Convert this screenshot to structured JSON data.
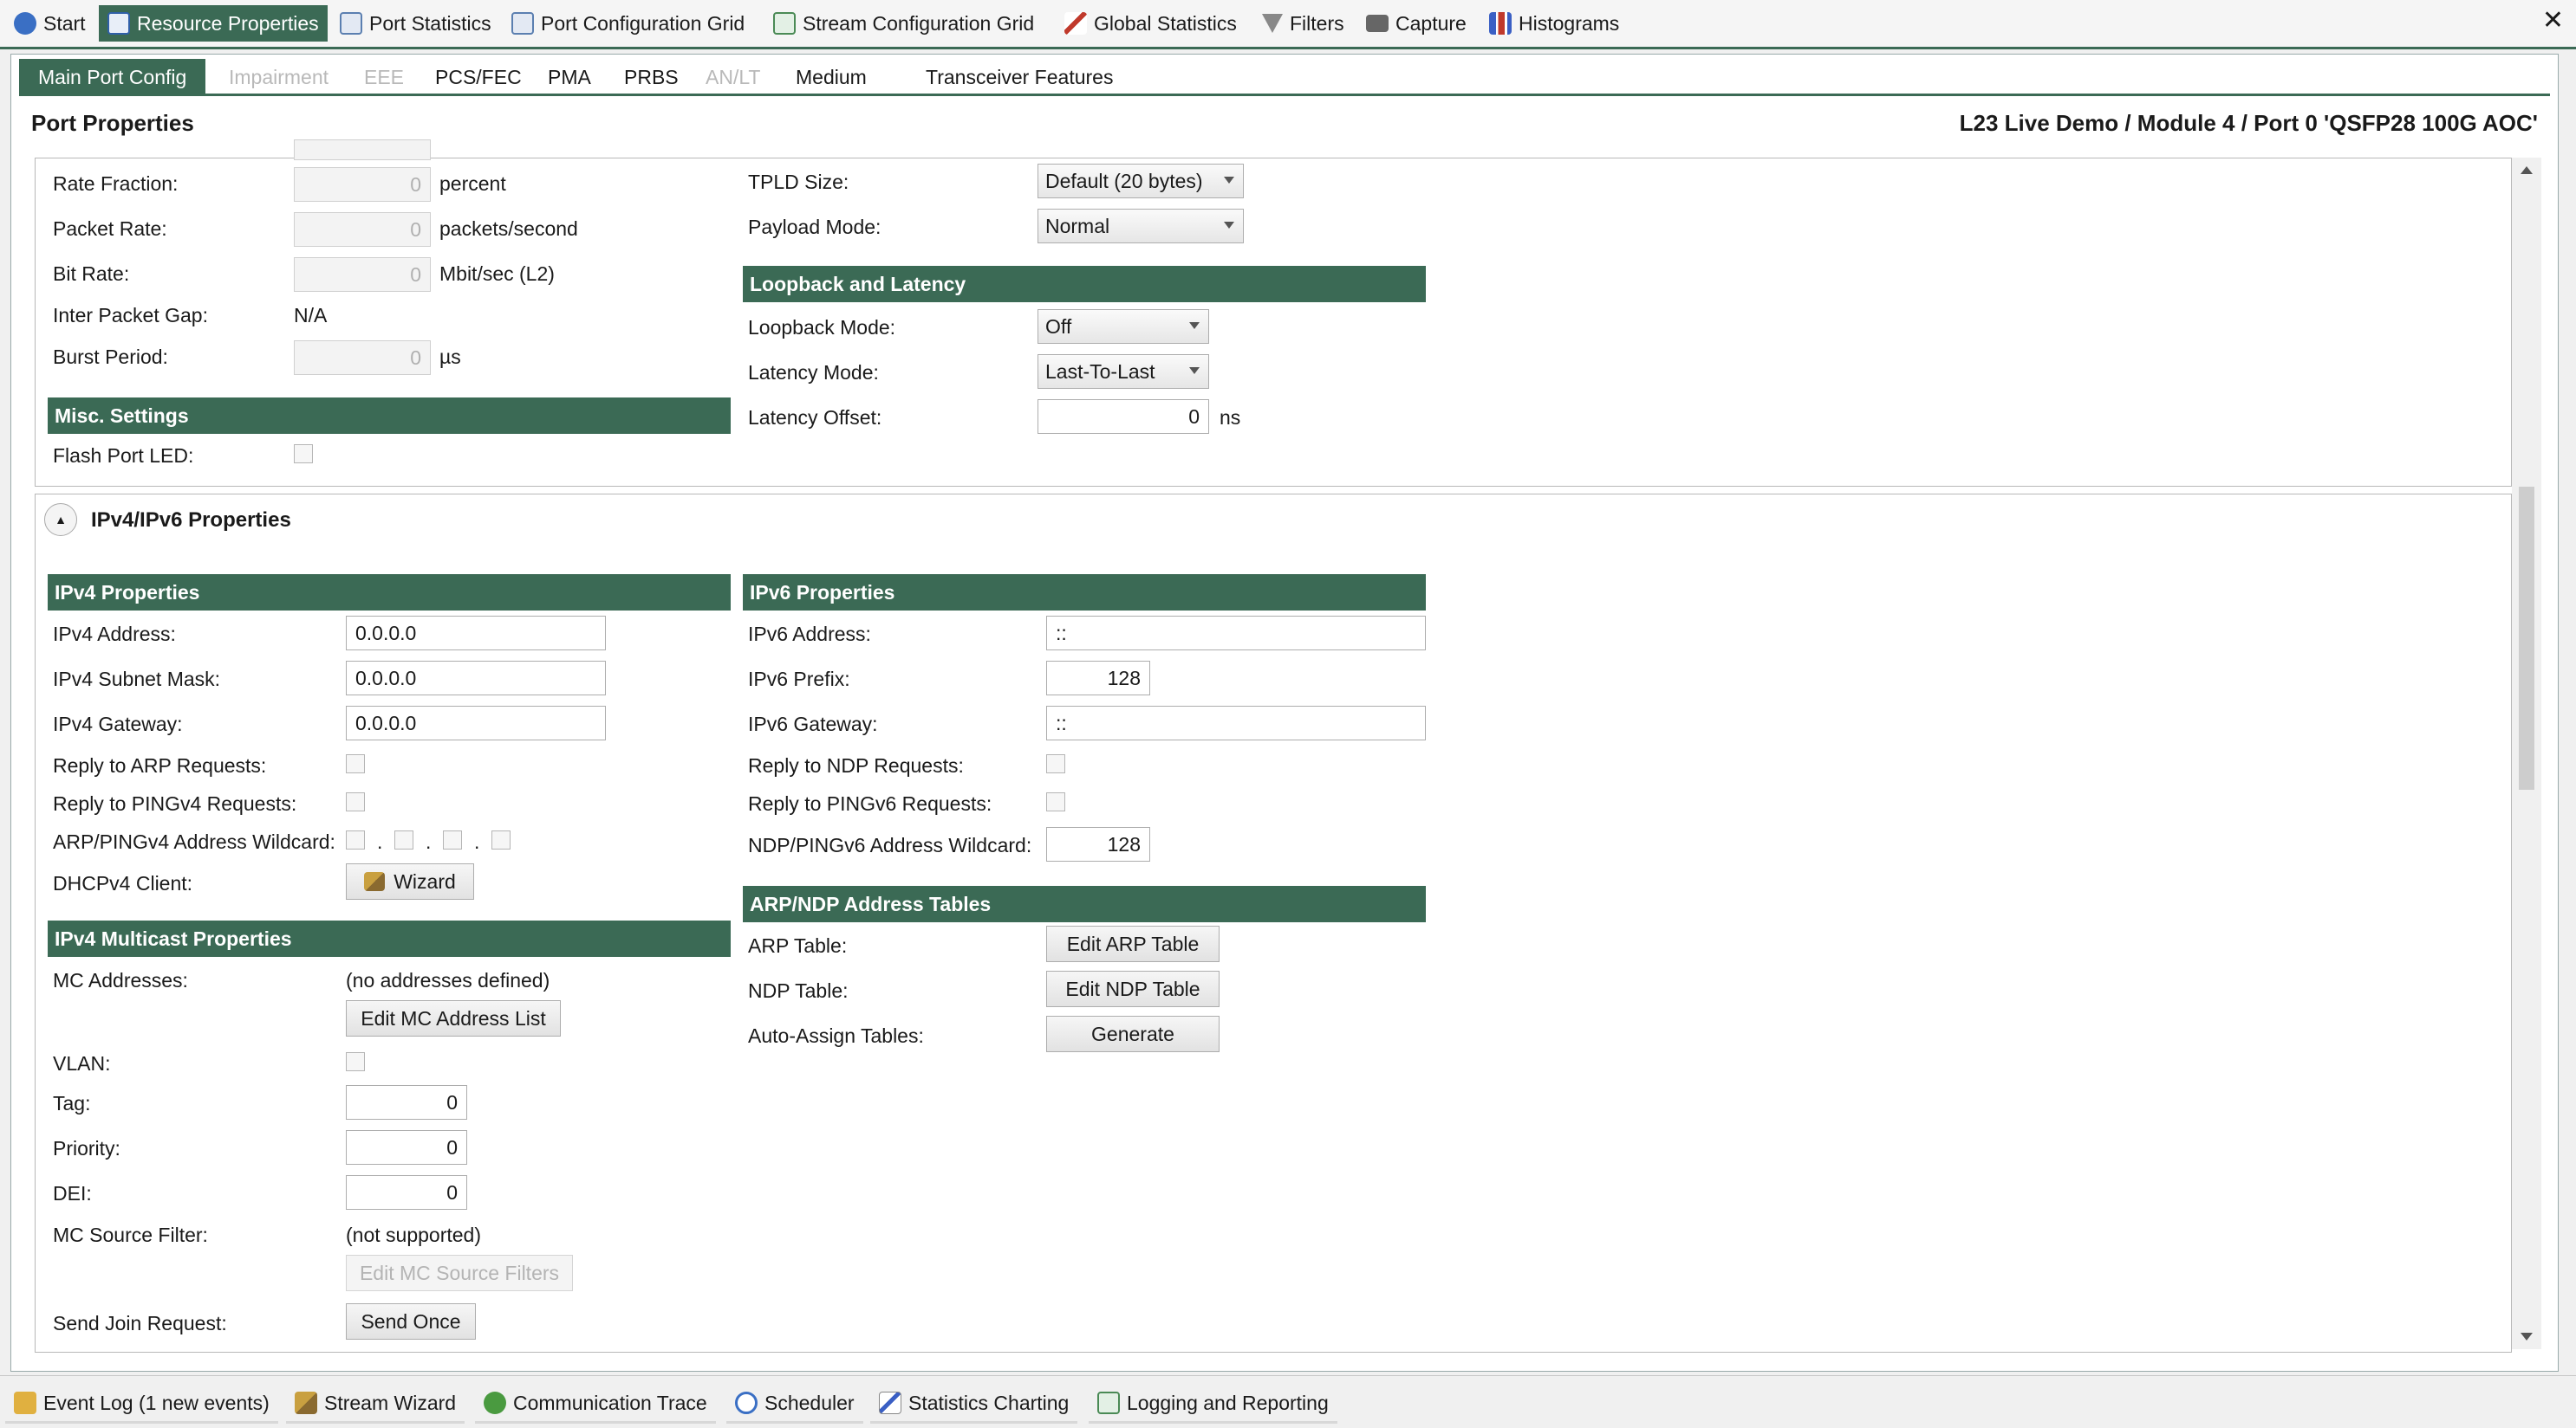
{
  "top_tabs": [
    {
      "label": "Start",
      "icon": "info-icon",
      "color": "#3a6fc4"
    },
    {
      "label": "Resource Properties",
      "icon": "properties-icon",
      "color": "#2f5fa8"
    },
    {
      "label": "Port Statistics",
      "icon": "grid-icon",
      "color": "#5b7fb0"
    },
    {
      "label": "Port Configuration Grid",
      "icon": "grid-icon",
      "color": "#5b7fb0"
    },
    {
      "label": "Stream Configuration Grid",
      "icon": "grid-icon",
      "color": "#4a8a55"
    },
    {
      "label": "Global Statistics",
      "icon": "chart-icon",
      "color": "#c0392b"
    },
    {
      "label": "Filters",
      "icon": "filter-icon",
      "color": "#777777"
    },
    {
      "label": "Capture",
      "icon": "camera-icon",
      "color": "#555555"
    },
    {
      "label": "Histograms",
      "icon": "histogram-icon",
      "color": "#3a5fc4"
    }
  ],
  "close_label": "✕",
  "sub_tabs": [
    {
      "label": "Main Port Config"
    },
    {
      "label": "Impairment"
    },
    {
      "label": "EEE"
    },
    {
      "label": "PCS/FEC"
    },
    {
      "label": "PMA"
    },
    {
      "label": "PRBS"
    },
    {
      "label": "AN/LT"
    },
    {
      "label": "Medium"
    },
    {
      "label": "Transceiver Features"
    }
  ],
  "header": {
    "title": "Port Properties",
    "path": "L23 Live Demo / Module 4 / Port 0 'QSFP28 100G AOC'"
  },
  "rate": {
    "fraction_label": "Rate Fraction:",
    "fraction_value": "0",
    "fraction_unit": "percent",
    "packet_label": "Packet Rate:",
    "packet_value": "0",
    "packet_unit": "packets/second",
    "bit_label": "Bit Rate:",
    "bit_value": "0",
    "bit_unit": "Mbit/sec (L2)",
    "ipg_label": "Inter Packet Gap:",
    "ipg_value": "N/A",
    "burst_label": "Burst Period:",
    "burst_value": "0",
    "burst_unit": "µs"
  },
  "misc": {
    "title": "Misc. Settings",
    "flash_label": "Flash Port LED:"
  },
  "tpld": {
    "size_label": "TPLD Size:",
    "size_value": "Default (20 bytes)",
    "payload_label": "Payload Mode:",
    "payload_value": "Normal"
  },
  "loopback": {
    "title": "Loopback and Latency",
    "mode_label": "Loopback Mode:",
    "mode_value": "Off",
    "latency_label": "Latency Mode:",
    "latency_value": "Last-To-Last",
    "offset_label": "Latency Offset:",
    "offset_value": "0",
    "offset_unit": "ns"
  },
  "ip_section": {
    "title": "IPv4/IPv6 Properties"
  },
  "ipv4": {
    "title": "IPv4 Properties",
    "address_label": "IPv4 Address:",
    "address_value": "0.0.0.0",
    "mask_label": "IPv4 Subnet Mask:",
    "mask_value": "0.0.0.0",
    "gateway_label": "IPv4 Gateway:",
    "gateway_value": "0.0.0.0",
    "arp_label": "Reply to ARP Requests:",
    "ping_label": "Reply to PINGv4 Requests:",
    "wildcard_label": "ARP/PINGv4 Address Wildcard:",
    "dhcp_label": "DHCPv4 Client:",
    "wizard_label": "Wizard"
  },
  "ipv6": {
    "title": "IPv6 Properties",
    "address_label": "IPv6 Address:",
    "address_value": "::",
    "prefix_label": "IPv6 Prefix:",
    "prefix_value": "128",
    "gateway_label": "IPv6 Gateway:",
    "gateway_value": "::",
    "ndp_label": "Reply to NDP Requests:",
    "ping_label": "Reply to PINGv6 Requests:",
    "wildcard_label": "NDP/PINGv6 Address Wildcard:",
    "wildcard_value": "128"
  },
  "tables": {
    "title": "ARP/NDP Address Tables",
    "arp_label": "ARP Table:",
    "arp_button": "Edit ARP Table",
    "ndp_label": "NDP Table:",
    "ndp_button": "Edit NDP Table",
    "auto_label": "Auto-Assign Tables:",
    "auto_button": "Generate"
  },
  "multicast": {
    "title": "IPv4 Multicast Properties",
    "mc_label": "MC Addresses:",
    "mc_value": "(no addresses defined)",
    "mc_button": "Edit MC Address List",
    "vlan_label": "VLAN:",
    "tag_label": "Tag:",
    "tag_value": "0",
    "priority_label": "Priority:",
    "priority_value": "0",
    "dei_label": "DEI:",
    "dei_value": "0",
    "source_label": "MC Source Filter:",
    "source_value": "(not supported)",
    "source_button": "Edit MC Source Filters",
    "join_label": "Send Join Request:",
    "join_button": "Send Once"
  },
  "bottom_tabs": [
    {
      "label": "Event Log (1 new events)",
      "icon": "event-log-icon",
      "color": "#d8a020"
    },
    {
      "label": "Stream Wizard",
      "icon": "wand-icon",
      "color": "#b08020"
    },
    {
      "label": "Communication Trace",
      "icon": "trace-icon",
      "color": "#4a9a40"
    },
    {
      "label": "Scheduler",
      "icon": "clock-icon",
      "color": "#3a6fc4"
    },
    {
      "label": "Statistics Charting",
      "icon": "chart-icon",
      "color": "#3a5fc4"
    },
    {
      "label": "Logging and Reporting",
      "icon": "report-icon",
      "color": "#4a8a55"
    }
  ]
}
